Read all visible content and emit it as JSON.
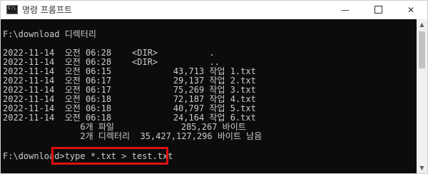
{
  "window": {
    "title": "명령 프롬프트",
    "icon_label": "C:\\",
    "min_glyph": "—",
    "close_glyph": "✕"
  },
  "console": {
    "lines": [
      "F:\\download 디렉터리",
      "2022-11-14  오전 06:28    <DIR>          .",
      "2022-11-14  오전 06:28    <DIR>          ..",
      "2022-11-14  오전 06:15            43,713 작업 1.txt",
      "2022-11-14  오전 06:17            29,137 작업 2.txt",
      "2022-11-14  오전 06:17            75,269 작업 3.txt",
      "2022-11-14  오전 06:18            72,187 작업 4.txt",
      "2022-11-14  오전 06:18            40,797 작업 5.txt",
      "2022-11-14  오전 06:18            24,164 작업 6.txt",
      "               6개 파일             285,267 바이트",
      "               2개 디렉터리  35,427,127,296 바이트 남음",
      "F:\\download>type *.txt > test.txt"
    ]
  },
  "scrollbar": {
    "up_glyph": "▲",
    "down_glyph": "▼"
  },
  "colors": {
    "console_bg": "#0c0c0c",
    "console_text": "#cccccc",
    "highlight": "#e01010"
  }
}
